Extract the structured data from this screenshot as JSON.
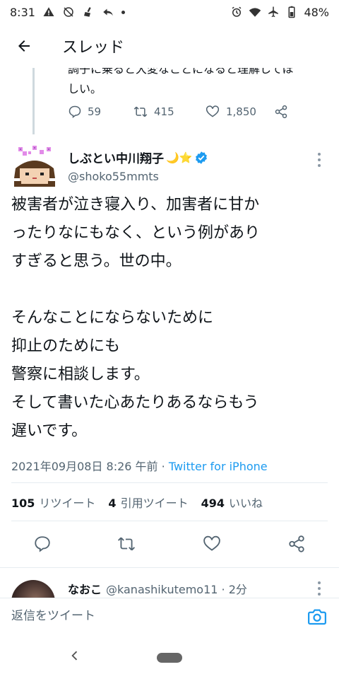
{
  "statusbar": {
    "time": "8:31",
    "battery": "48%"
  },
  "header": {
    "title": "スレッド"
  },
  "prev_tweet": {
    "text_line1": "調子に乗ると大変なことになると理解してほ",
    "text_line2": "しい。",
    "replies": "59",
    "retweets": "415",
    "likes": "1,850"
  },
  "tweet": {
    "display_name": "しぶとい中川翔子",
    "name_emoji": "🌙⭐",
    "handle": "@shoko55mmts",
    "body": [
      "被害者が泣き寝入り、加害者に甘か",
      "ったりなにもなく、という例があり",
      "すぎると思う。世の中。",
      "",
      "そんなことにならないために",
      "抑止のためにも",
      "警察に相談します。",
      "そして書いた心あたりあるならもう",
      "遅いです。"
    ],
    "timestamp": "2021年09月08日 8:26 午前 · ",
    "source": "Twitter for iPhone",
    "retweet_count": "105",
    "retweet_label": "リツイート",
    "quote_count": "4",
    "quote_label": "引用ツイート",
    "like_count": "494",
    "like_label": "いいね"
  },
  "reply_preview": {
    "name": "なおこ",
    "handle_time": "@kanashikutemo11 · 2分"
  },
  "compose": {
    "placeholder": "返信をツイート"
  },
  "colors": {
    "accent": "#1d9bf0",
    "secondary_text": "#536471",
    "divider": "#e6ecf0"
  }
}
